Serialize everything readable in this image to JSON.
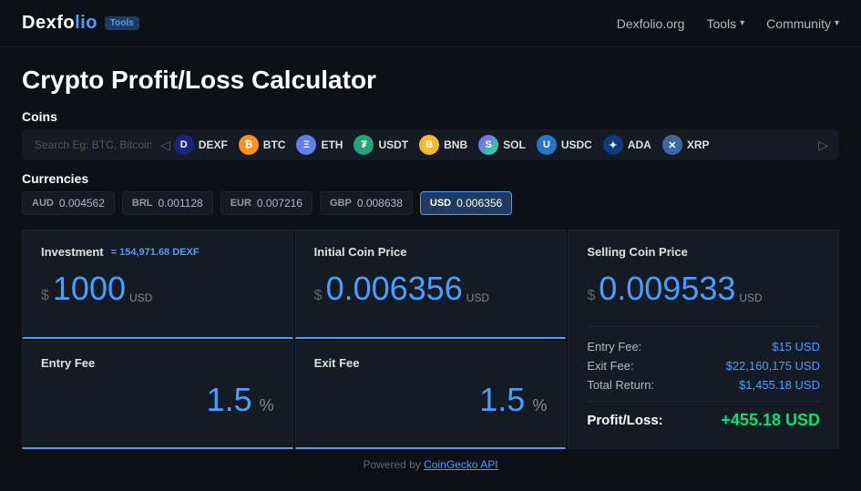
{
  "brand": {
    "name_part1": "Dexfo",
    "name_part2": "lio",
    "badge": "Tools"
  },
  "nav": {
    "site_link": "Dexfolio.org",
    "tools_label": "Tools",
    "community_label": "Community"
  },
  "page": {
    "title": "Crypto Profit/Loss Calculator"
  },
  "coins": {
    "section_label": "Coins",
    "search_placeholder": "Search Eg: BTC, Bitcoin, etc.",
    "items": [
      {
        "symbol": "DEXF",
        "class": "dexf",
        "char": "D"
      },
      {
        "symbol": "BTC",
        "class": "btc",
        "char": "₿"
      },
      {
        "symbol": "ETH",
        "class": "eth",
        "char": "Ξ"
      },
      {
        "symbol": "USDT",
        "class": "usdt",
        "char": "₮"
      },
      {
        "symbol": "BNB",
        "class": "bnb",
        "char": "B"
      },
      {
        "symbol": "SOL",
        "class": "sol",
        "char": "S"
      },
      {
        "symbol": "USDC",
        "class": "usdc",
        "char": "U"
      },
      {
        "symbol": "ADA",
        "class": "ada",
        "char": "✦"
      },
      {
        "symbol": "XRP",
        "class": "xrp",
        "char": "✕"
      }
    ]
  },
  "currencies": {
    "section_label": "Currencies",
    "items": [
      {
        "code": "AUD",
        "value": "0.004562",
        "active": false
      },
      {
        "code": "BRL",
        "value": "0.001128",
        "active": false
      },
      {
        "code": "EUR",
        "value": "0.007216",
        "active": false
      },
      {
        "code": "GBP",
        "value": "0.008638",
        "active": false
      },
      {
        "code": "USD",
        "value": "0.006356",
        "active": true
      }
    ]
  },
  "calculator": {
    "investment": {
      "label": "Investment",
      "sublabel": "= 154,971.68 DEXF",
      "prefix": "$",
      "value": "1000",
      "unit": "USD"
    },
    "initial_price": {
      "label": "Initial Coin Price",
      "prefix": "$",
      "value": "0.006356",
      "unit": "USD"
    },
    "selling_price": {
      "label": "Selling Coin Price",
      "prefix": "$",
      "value": "0.009533",
      "unit": "USD"
    },
    "entry_fee": {
      "label": "Entry Fee",
      "value": "1.5",
      "unit": "%"
    },
    "exit_fee": {
      "label": "Exit Fee",
      "value": "1.5",
      "unit": "%"
    },
    "results": {
      "entry_fee_label": "Entry Fee:",
      "entry_fee_value": "$15 USD",
      "exit_fee_label": "Exit Fee:",
      "exit_fee_value": "$22,160,175 USD",
      "total_return_label": "Total Return:",
      "total_return_value": "$1,455.18 USD",
      "profit_loss_label": "Profit/Loss:",
      "profit_loss_value": "+455.18 USD"
    }
  },
  "footer": {
    "text": "Powered by ",
    "link_text": "CoinGecko API"
  }
}
